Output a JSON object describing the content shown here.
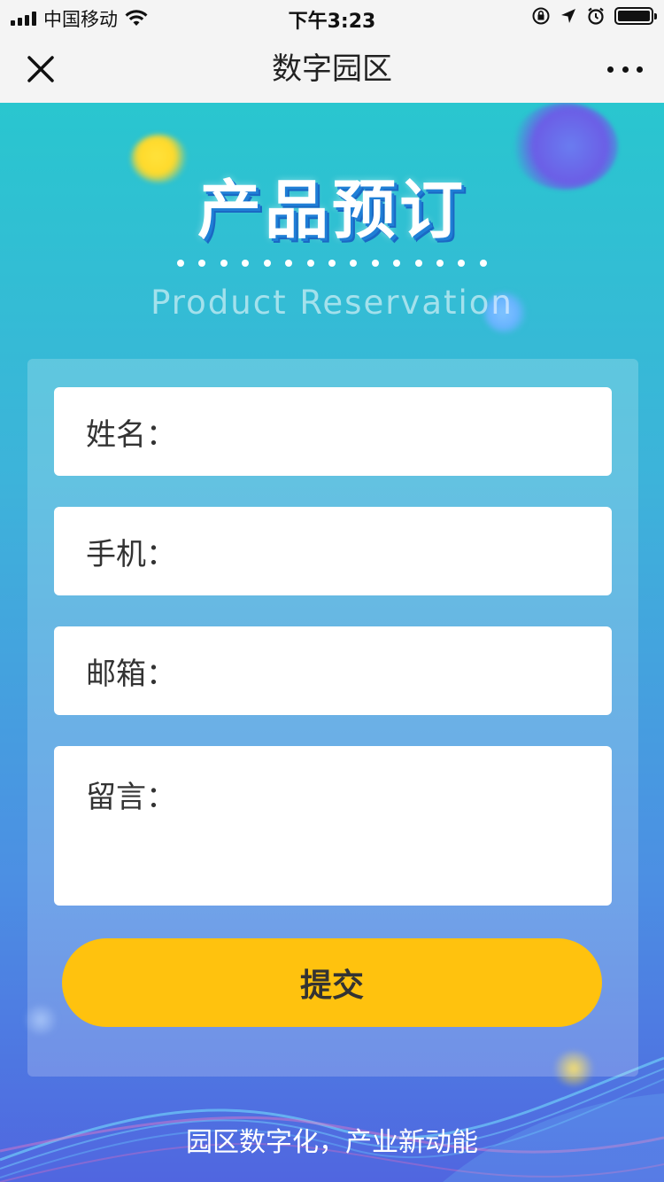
{
  "status_bar": {
    "carrier": "中国移动",
    "time": "下午3:23"
  },
  "nav": {
    "title": "数字园区",
    "close_icon": "close-icon",
    "more_icon": "more-dots-icon"
  },
  "hero": {
    "title": "产品预订",
    "subtitle": "Product Reservation"
  },
  "form": {
    "fields": [
      {
        "label": "姓名：",
        "value": "",
        "placeholder": ""
      },
      {
        "label": "手机：",
        "value": "",
        "placeholder": ""
      },
      {
        "label": "邮箱：",
        "value": "",
        "placeholder": ""
      },
      {
        "label": "留言：",
        "value": "",
        "placeholder": ""
      }
    ],
    "submit_label": "提交"
  },
  "footer": {
    "slogan": "园区数字化，产业新动能"
  },
  "colors": {
    "accent_button": "#ffc20e",
    "gradient_top": "#29c6cf",
    "gradient_bottom": "#5066e0"
  }
}
